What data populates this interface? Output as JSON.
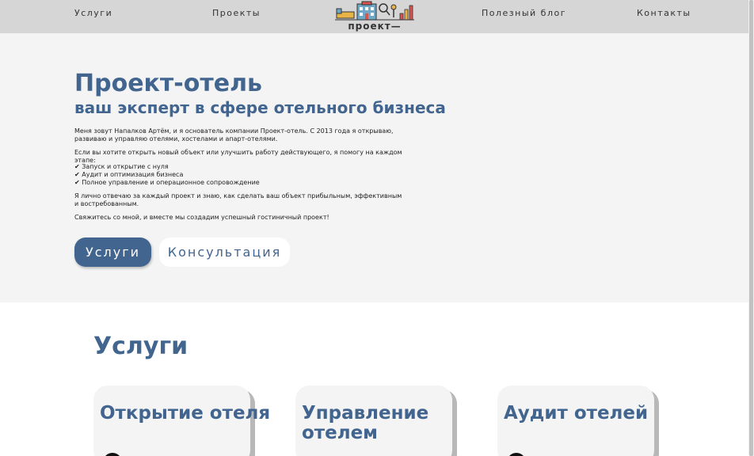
{
  "nav": {
    "services": "Услуги",
    "projects": "Проекты",
    "blog": "Полезный блог",
    "contacts": "Контакты"
  },
  "logo": {
    "text": "проект—отель"
  },
  "hero": {
    "title": "Проект-отель",
    "subtitle": "ваш эксперт в сфере отельного бизнеса",
    "intro": "Меня зовут Напалков Артём, и я основатель компании Проект-отель. С 2013 года я открываю, развиваю и управляю отелями, хостелами и апарт-отелями.",
    "lead": "Если вы хотите открыть новый объект или улучшить работу действующего, я помогу на каждом этапе:",
    "list": [
      "✔ Запуск и открытие с нуля",
      "✔ Аудит и оптимизация бизнеса",
      "✔ Полное управление и операционное сопровождение"
    ],
    "responsibility": "Я лично отвечаю за каждый проект и знаю, как сделать ваш объект прибыльным, эффективным и востребованным.",
    "cta": "Свяжитесь со мной, и вместе мы создадим успешный гостиничный проект!",
    "button_services": "Услуги",
    "button_consult": "Консультация"
  },
  "services": {
    "title": "Услуги",
    "cards": [
      {
        "title": "Открытие отеля"
      },
      {
        "title": "Управление отелем"
      },
      {
        "title": "Аудит отелей"
      }
    ]
  },
  "colors": {
    "accent": "#41658f",
    "header_bg": "#d6d6d6",
    "hero_bg": "#f4f4f4"
  }
}
